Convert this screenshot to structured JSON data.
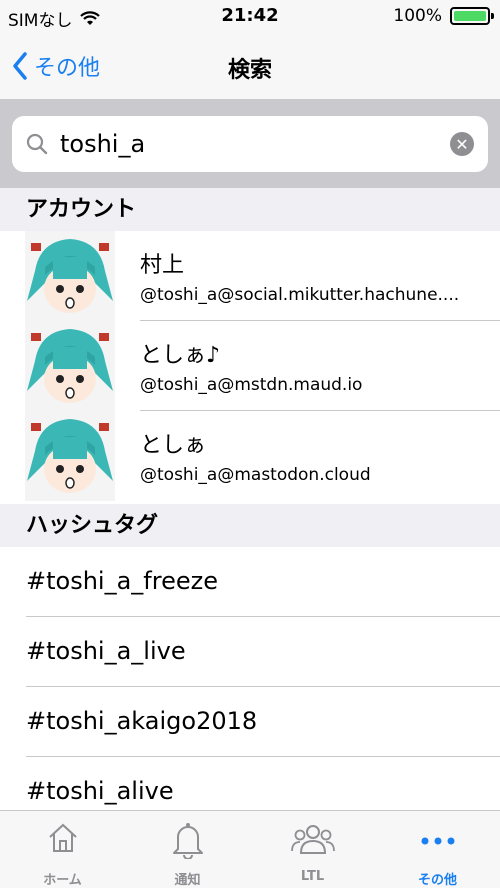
{
  "status": {
    "carrier": "SIMなし",
    "time": "21:42",
    "battery": "100%"
  },
  "nav": {
    "back_label": "その他",
    "title": "検索"
  },
  "search": {
    "query": "toshi_a"
  },
  "sections": {
    "accounts": "アカウント",
    "hashtags": "ハッシュタグ"
  },
  "accounts": [
    {
      "name": "村上",
      "handle": "@toshi_a@social.mikutter.hachune...."
    },
    {
      "name": "としぁ♪",
      "handle": "@toshi_a@mstdn.maud.io"
    },
    {
      "name": "としぁ",
      "handle": "@toshi_a@mastodon.cloud"
    }
  ],
  "hashtags": [
    "#toshi_a_freeze",
    "#toshi_a_live",
    "#toshi_akaigo2018",
    "#toshi_alive"
  ],
  "tabs": [
    {
      "label": "ホーム",
      "icon": "home-icon"
    },
    {
      "label": "通知",
      "icon": "bell-icon"
    },
    {
      "label": "LTL",
      "icon": "people-icon"
    },
    {
      "label": "その他",
      "icon": "more-icon",
      "active": true
    }
  ],
  "colors": {
    "accent": "#1a7ff0",
    "battery": "#4cd964",
    "search_bg": "#c9c9ce",
    "section_bg": "#efeff4"
  }
}
